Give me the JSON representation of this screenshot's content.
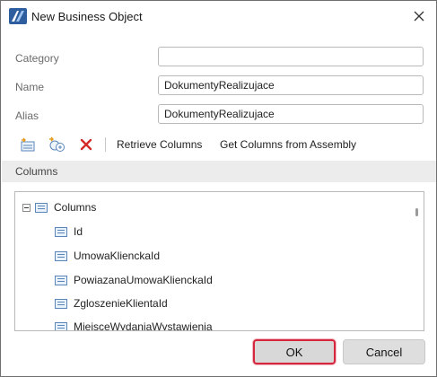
{
  "window": {
    "title": "New Business Object",
    "icon": "app-logo-icon"
  },
  "form": {
    "category": {
      "label": "Category",
      "value": "",
      "placeholder": ""
    },
    "name": {
      "label": "Name",
      "value": "DokumentyRealizujace"
    },
    "alias": {
      "label": "Alias",
      "value": "DokumentyRealizujace"
    }
  },
  "toolbar": {
    "icons": [
      "add-column-icon",
      "add-calculated-column-icon",
      "delete-icon"
    ],
    "retrieve_label": "Retrieve Columns",
    "assembly_label": "Get Columns from Assembly"
  },
  "columns_section": {
    "title": "Columns",
    "root_label": "Columns",
    "items": [
      {
        "label": "Id"
      },
      {
        "label": "UmowaKlienckaId"
      },
      {
        "label": "PowiazanaUmowaKlienckaId"
      },
      {
        "label": "ZgloszenieKlientaId"
      },
      {
        "label": "MiejsceWydaniaWystawienia"
      }
    ]
  },
  "buttons": {
    "ok_label": "OK",
    "cancel_label": "Cancel"
  },
  "colors": {
    "accent": "#d7263d",
    "delete": "#d42a2a",
    "icon_blue": "#5a86b8"
  }
}
